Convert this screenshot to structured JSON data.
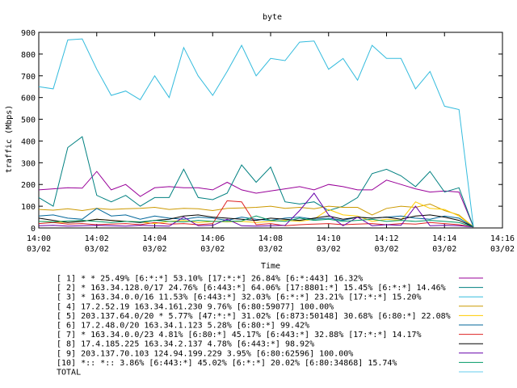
{
  "chart_data": {
    "type": "line",
    "title": "byte",
    "xlabel": "Time",
    "ylabel": "traffic (Mbps)",
    "ylim": [
      0,
      900
    ],
    "yticks": [
      0,
      100,
      200,
      300,
      400,
      500,
      600,
      700,
      800,
      900
    ],
    "xticks": [
      {
        "time": "14:00",
        "date": "03/02"
      },
      {
        "time": "14:02",
        "date": "03/02"
      },
      {
        "time": "14:04",
        "date": "03/02"
      },
      {
        "time": "14:06",
        "date": "03/02"
      },
      {
        "time": "14:08",
        "date": "03/02"
      },
      {
        "time": "14:10",
        "date": "03/02"
      },
      {
        "time": "14:12",
        "date": "03/02"
      },
      {
        "time": "14:14",
        "date": "03/02"
      },
      {
        "time": "14:16",
        "date": "03/02"
      }
    ],
    "x_minutes": [
      0,
      0.5,
      1,
      1.5,
      2,
      2.5,
      3,
      3.5,
      4,
      4.5,
      5,
      5.5,
      6,
      6.5,
      7,
      7.5,
      8,
      8.5,
      9,
      9.5,
      10,
      10.5,
      11,
      11.5,
      12,
      12.5,
      13,
      13.5,
      14,
      14.5,
      15
    ],
    "grid": false,
    "legend_position": "bottom",
    "series": [
      {
        "name": "[ 1] * * 25.49%  [6:*:*] 53.10% [17:*:*] 26.84% [6:*:443] 16.32%",
        "color": "#990099",
        "values": [
          175,
          180,
          185,
          183,
          260,
          175,
          200,
          145,
          185,
          190,
          185,
          185,
          175,
          210,
          175,
          160,
          170,
          180,
          190,
          175,
          200,
          190,
          175,
          175,
          220,
          200,
          180,
          165,
          170,
          165,
          5
        ]
      },
      {
        "name": "[ 2] * 163.34.128.0/17 24.76%  [6:443:*] 64.06% [17:8801:*] 15.45% [6:*:*] 14.46%",
        "color": "#008080",
        "values": [
          140,
          100,
          370,
          420,
          150,
          120,
          150,
          100,
          140,
          140,
          270,
          140,
          130,
          160,
          290,
          210,
          280,
          120,
          110,
          120,
          80,
          100,
          140,
          250,
          270,
          240,
          190,
          260,
          165,
          185,
          5
        ]
      },
      {
        "name": "[ 3] * 163.34.0.0/16 11.53%  [6:443:*] 32.03% [6:*:*] 23.21% [17:*:*] 15.20%",
        "color": "#33bbdd",
        "values": [
          650,
          640,
          865,
          870,
          730,
          610,
          630,
          590,
          700,
          600,
          830,
          700,
          610,
          720,
          840,
          700,
          780,
          770,
          855,
          860,
          730,
          780,
          680,
          840,
          780,
          780,
          640,
          720,
          560,
          545,
          5
        ]
      },
      {
        "name": "[ 4] 17.2.52.19 163.34.161.230 9.76%  [6:80:59077] 100.00%",
        "color": "#cc9900",
        "values": [
          85,
          82,
          88,
          80,
          90,
          85,
          88,
          90,
          95,
          85,
          90,
          88,
          80,
          90,
          92,
          95,
          100,
          90,
          95,
          88,
          100,
          95,
          95,
          60,
          90,
          100,
          95,
          110,
          80,
          60,
          5
        ]
      },
      {
        "name": "[ 5] 203.137.64.0/20 * 5.77%  [47:*:*] 31.02% [6:873:50148] 30.68% [6:80:*] 22.08%",
        "color": "#ffcc00",
        "values": [
          30,
          28,
          25,
          30,
          40,
          35,
          30,
          28,
          20,
          30,
          35,
          25,
          30,
          28,
          30,
          25,
          30,
          35,
          30,
          40,
          85,
          60,
          55,
          30,
          40,
          35,
          120,
          90,
          85,
          55,
          5
        ]
      },
      {
        "name": "[ 6] 17.2.48.0/20 163.34.1.123 5.28%  [6:80:*] 99.42%",
        "color": "#006699",
        "values": [
          55,
          60,
          45,
          40,
          90,
          55,
          60,
          40,
          55,
          45,
          40,
          50,
          45,
          35,
          50,
          40,
          35,
          45,
          50,
          40,
          45,
          35,
          50,
          45,
          50,
          55,
          45,
          40,
          55,
          45,
          5
        ]
      },
      {
        "name": "[ 7] * 163.34.0.0/23 4.81%  [6:80:*] 45.17% [6:443:*] 32.88% [17:*:*] 14.17%",
        "color": "#dd2222",
        "values": [
          20,
          25,
          18,
          20,
          15,
          18,
          20,
          15,
          25,
          18,
          20,
          15,
          20,
          125,
          120,
          15,
          20,
          10,
          15,
          18,
          20,
          15,
          18,
          20,
          15,
          20,
          18,
          25,
          20,
          15,
          5
        ]
      },
      {
        "name": "[ 8] 17.4.185.225 163.34.2.137 4.78%  [6:443:*] 98.92%",
        "color": "#000000",
        "values": [
          45,
          35,
          25,
          30,
          40,
          35,
          30,
          25,
          35,
          40,
          55,
          60,
          50,
          45,
          40,
          35,
          45,
          40,
          35,
          45,
          55,
          40,
          50,
          45,
          50,
          40,
          55,
          60,
          50,
          35,
          5
        ]
      },
      {
        "name": "[ 9] 203.137.70.103 124.94.199.229 3.95%  [6:80:62596] 100.00%",
        "color": "#6600aa",
        "values": [
          10,
          12,
          8,
          10,
          12,
          10,
          8,
          12,
          10,
          8,
          50,
          10,
          12,
          40,
          10,
          8,
          10,
          12,
          80,
          160,
          60,
          10,
          50,
          10,
          15,
          12,
          100,
          10,
          12,
          10,
          5
        ]
      },
      {
        "name": "[10] *:: *:: 3.86%  [6:443:*] 45.02% [6:*:*] 20.02% [6:80:34868] 15.74%",
        "color": "#009966",
        "values": [
          30,
          28,
          32,
          35,
          30,
          25,
          30,
          28,
          35,
          30,
          28,
          35,
          30,
          30,
          32,
          55,
          35,
          30,
          45,
          35,
          40,
          30,
          35,
          40,
          30,
          35,
          30,
          35,
          30,
          25,
          5
        ]
      },
      {
        "name": "TOTAL",
        "color": "#66ccee",
        "values": []
      }
    ]
  }
}
